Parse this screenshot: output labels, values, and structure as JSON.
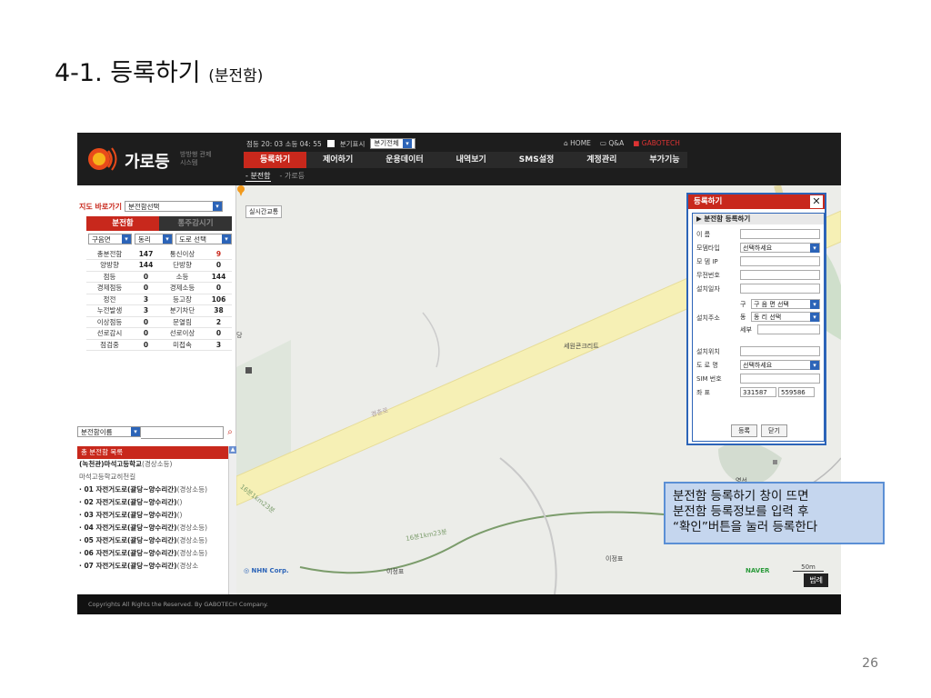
{
  "slide": {
    "title": "4-1. 등록하기",
    "title_sub": "(분전함)",
    "page_number": "26"
  },
  "header": {
    "logo_text": "가로등",
    "logo_sub": "방방행 관제시스템",
    "status": {
      "summary": "점등 20: 03 소등 04: 55",
      "checkbox_label": "분기표시",
      "select_value": "분기전체"
    },
    "top_links": [
      "HOME",
      "Q&A",
      "GABOTECH"
    ],
    "nav_tabs": [
      "등록하기",
      "제어하기",
      "운용데이터",
      "내역보기",
      "SMS설정",
      "계정관리",
      "부가기능"
    ],
    "sub_tabs": [
      "분전함",
      "가로등"
    ]
  },
  "sidebar": {
    "jump_label": "지도 바로가기",
    "jump_select": "분전함선택",
    "tabs": [
      "분전함",
      "통주감시기"
    ],
    "filters": [
      "구음면",
      "동리",
      "도로 선택"
    ],
    "stats": [
      [
        "총분전함",
        "147",
        "통신이상",
        "9"
      ],
      [
        "양방향",
        "144",
        "단방향",
        "0"
      ],
      [
        "점등",
        "0",
        "소등",
        "144"
      ],
      [
        "경제점등",
        "0",
        "경제소등",
        "0"
      ],
      [
        "정전",
        "3",
        "등고장",
        "106"
      ],
      [
        "누전발생",
        "3",
        "분기차단",
        "38"
      ],
      [
        "이상점등",
        "0",
        "문열림",
        "2"
      ],
      [
        "선로감시",
        "0",
        "선로이상",
        "0"
      ],
      [
        "점검중",
        "0",
        "미접속",
        "3"
      ]
    ],
    "search_select": "분전함이름",
    "list_title": "총 분전함 목록",
    "list_items": [
      {
        "name": "(녹천관)마석고등학교",
        "detail": "(경상소등)"
      },
      {
        "name": "",
        "detail": "마석고등학교히천길"
      },
      {
        "name": "· 01 자전거도로(괄당~양수리간)",
        "detail": "(경상소등)"
      },
      {
        "name": "· 02 자전거도로(괄당~양수리간)",
        "detail": "()"
      },
      {
        "name": "· 03 자전거도로(괄당~양수리간)",
        "detail": "()"
      },
      {
        "name": "· 04 자전거도로(괄당~양수리간)",
        "detail": "(경상소등)"
      },
      {
        "name": "· 05 자전거도로(괄당~양수리간)",
        "detail": "(경상소등)"
      },
      {
        "name": "· 06 자전거도로(괄당~양수리간)",
        "detail": "(경상소등)"
      },
      {
        "name": "· 07 자전거도로(괄당~양수리간)",
        "detail": "(경상소"
      }
    ]
  },
  "map": {
    "button": "실시간교통",
    "labels": {
      "concrete": "세원콘크리트",
      "road1": "경춘로",
      "road2": "16분1km23분",
      "road3": "16분1km23분",
      "place1": "이정표",
      "place2": "이정표",
      "place3": "영선",
      "place4": "교",
      "left_edge": "당",
      "provider": "NHN Corp.",
      "naver": "NAVER",
      "scale": "50m"
    },
    "legend_button": "범례"
  },
  "popup": {
    "title": "등록하기",
    "section": "▶ 분전함 등록하기",
    "fields": {
      "name": {
        "label": "이 름",
        "value": ""
      },
      "modem_type": {
        "label": "모뎀타입",
        "value": "선택하세요"
      },
      "modem_ip": {
        "label": "모 뎀 IP",
        "value": ""
      },
      "phone": {
        "label": "무전번호",
        "value": ""
      },
      "install_date": {
        "label": "설치일자",
        "value": ""
      },
      "address": {
        "label": "설치주소",
        "gu_label": "구",
        "gu_value": "구 음 면 선택",
        "dong_label": "동",
        "dong_value": "동 리 선택",
        "detail_label": "세부",
        "detail_value": ""
      },
      "location": {
        "label": "설치위치",
        "value": ""
      },
      "road": {
        "label": "도 로 명",
        "value": "선택하세요"
      },
      "sim": {
        "label": "SIM 번호",
        "value": ""
      },
      "coords": {
        "label": "좌 표",
        "x": "331587",
        "y": "559586"
      }
    },
    "buttons": {
      "register": "등록",
      "close": "닫기"
    }
  },
  "footer": {
    "text": "Copyrights All Rights the Reserved. By  GABOTECH Company."
  },
  "callout": {
    "lines": [
      "분전함 등록하기 창이 뜨면",
      "분전함 등록정보를 입력 후",
      "“확인”버튼을 눌러 등록한다"
    ]
  },
  "colors": {
    "accent_red": "#c8281c",
    "header_dark": "#1d1d1d",
    "highlight_blue": "#2c64b8",
    "callout_fill": "#c5d6ee"
  }
}
